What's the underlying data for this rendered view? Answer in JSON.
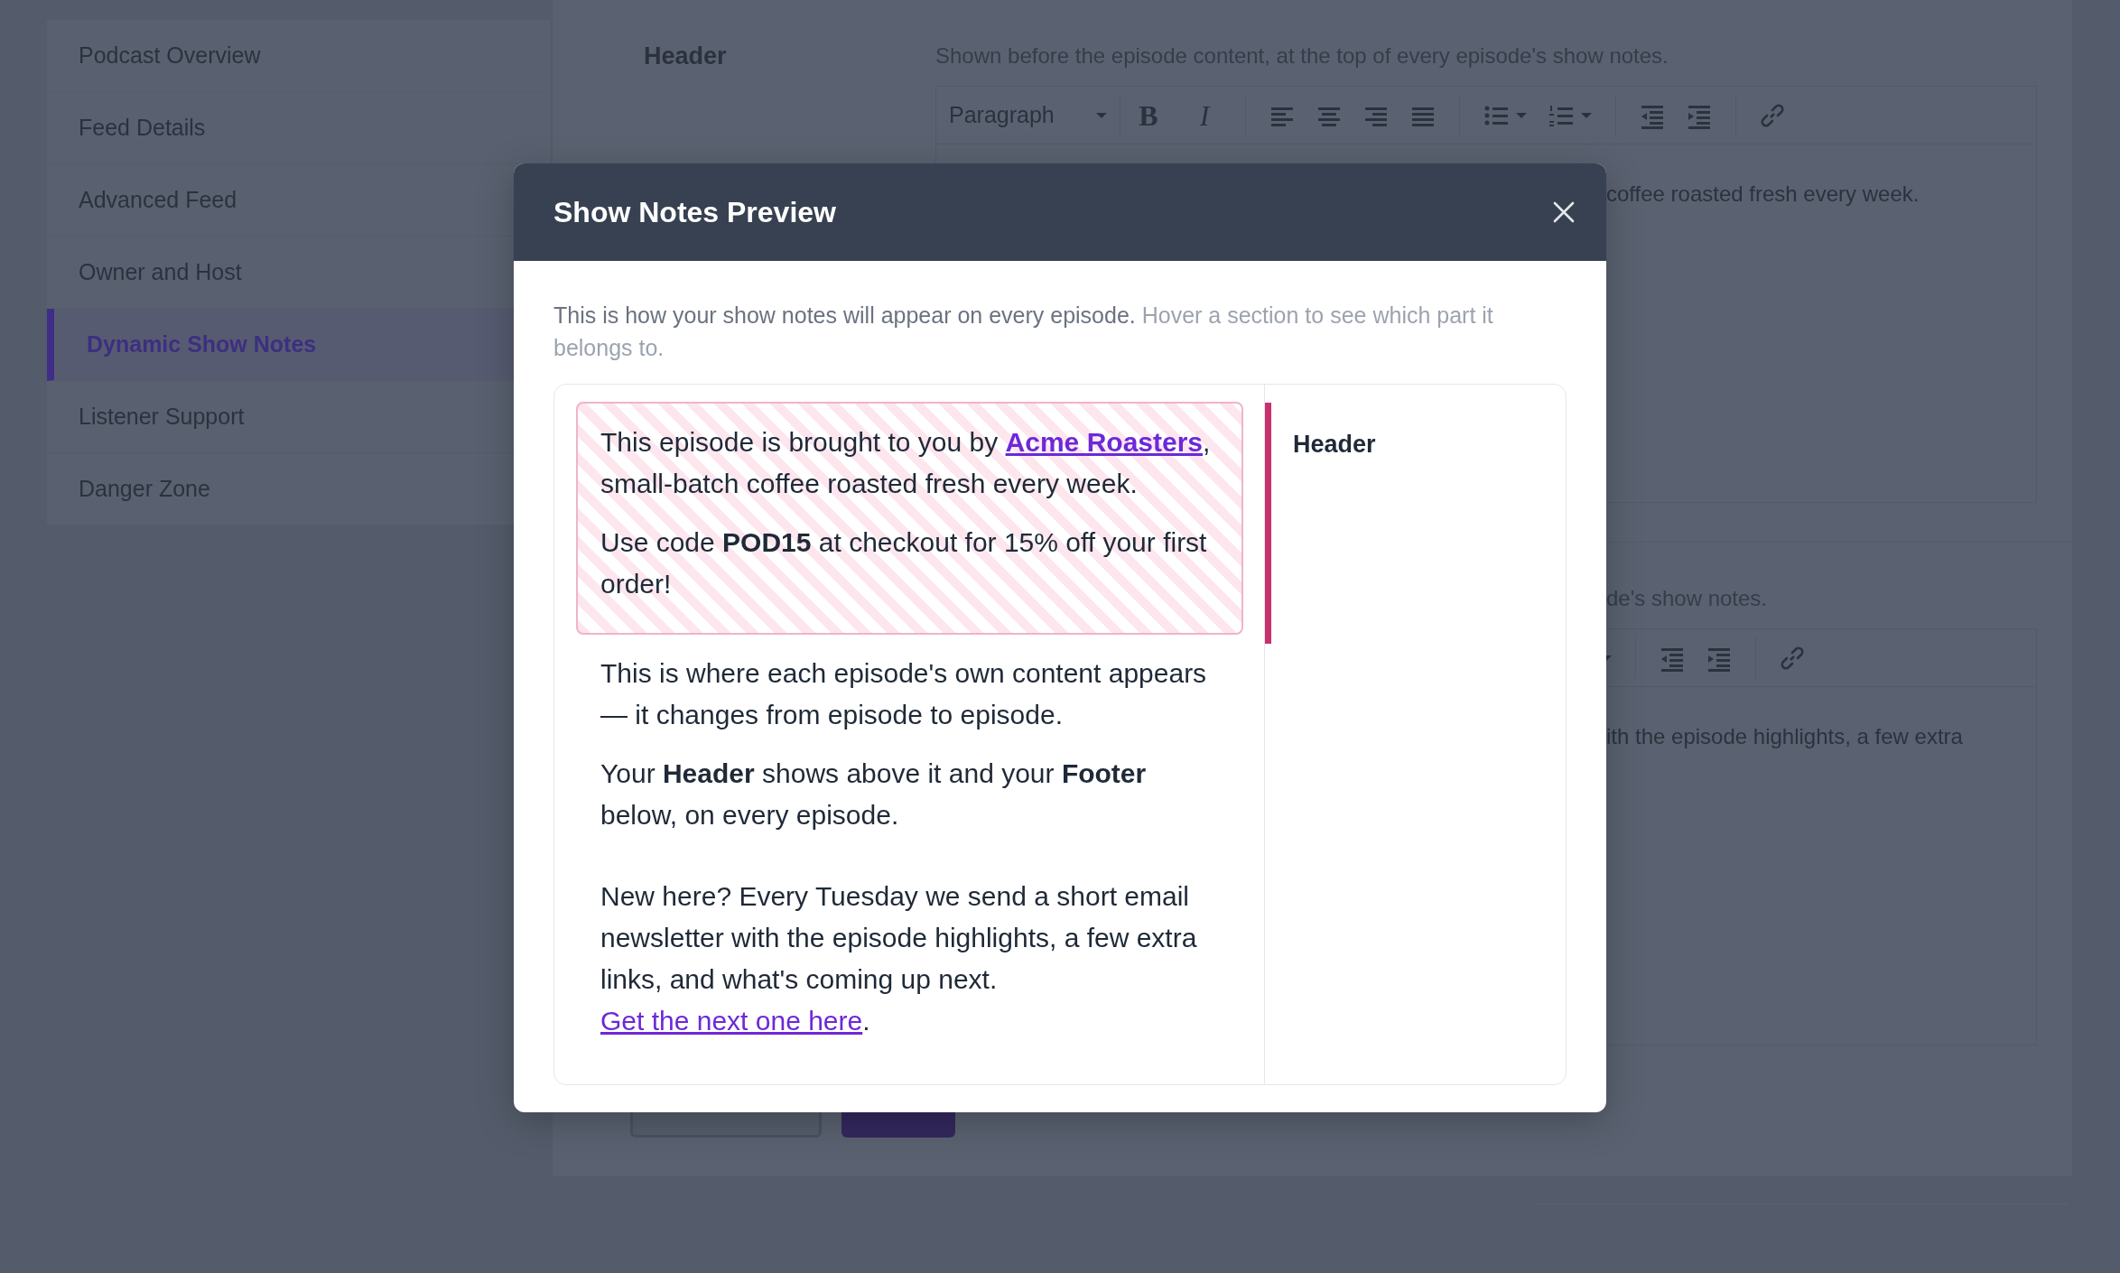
{
  "sidebar": {
    "items": [
      {
        "label": "Podcast Overview",
        "selected": false
      },
      {
        "label": "Feed Details",
        "selected": false
      },
      {
        "label": "Advanced Feed",
        "selected": false
      },
      {
        "label": "Owner and Host",
        "selected": false
      },
      {
        "label": "Dynamic Show Notes",
        "selected": true
      },
      {
        "label": "Listener Support",
        "selected": false
      },
      {
        "label": "Danger Zone",
        "selected": false
      }
    ]
  },
  "sections": [
    {
      "label": "Header",
      "description": "Shown before the episode content, at the top of every episode's show notes.",
      "format": "Paragraph",
      "bold_glyph": "B",
      "italic_glyph": "I",
      "content": "coffee roasted fresh every week."
    },
    {
      "description": "de's show notes.",
      "content": "ith the episode highlights, a few extra"
    }
  ],
  "modal": {
    "title": "Show Notes Preview",
    "intro": "This is how your show notes will appear on every episode.",
    "hint": "Hover a section to see which part it belongs to.",
    "blocks": [
      {
        "kind": "header",
        "hovered": true,
        "paragraphs": [
          [
            {
              "kind": "text",
              "text": "This episode is brought to you by "
            },
            {
              "kind": "link",
              "strong": true,
              "text": "Acme Roasters"
            },
            {
              "kind": "text",
              "text": ", small-batch coffee roasted fresh every week."
            }
          ],
          [
            {
              "kind": "text",
              "text": "Use code **POD15** at checkout for 15% off your first order!"
            }
          ]
        ]
      },
      {
        "kind": "content",
        "hovered": false,
        "paragraphs": [
          [
            {
              "kind": "text",
              "text": "This is where each episode's own content appears — it changes from episode to episode."
            }
          ],
          [
            {
              "kind": "text",
              "text": "Your **Header** shows above it and your **Footer** below, on every episode."
            }
          ]
        ]
      },
      {
        "kind": "footer",
        "hovered": false,
        "paragraphs": [
          [
            {
              "kind": "text",
              "text": "New here? Every Tuesday we send a short email newsletter with the episode highlights, a few extra links, and what's coming up next. "
            },
            {
              "kind": "link",
              "strong": false,
              "text": "Get the next one here"
            },
            {
              "kind": "text",
              "text": "."
            }
          ]
        ]
      }
    ],
    "legend": {
      "label": "Header",
      "color": "#c9306e"
    }
  }
}
